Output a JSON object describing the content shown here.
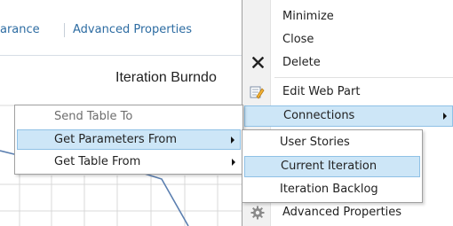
{
  "tabs": {
    "appearance": "arance",
    "advanced_properties": "Advanced Properties"
  },
  "chart": {
    "title": "Iteration Burndo"
  },
  "main_menu": {
    "minimize": "Minimize",
    "close": "Close",
    "delete": "Delete",
    "edit_web_part": "Edit Web Part",
    "connections": "Connections",
    "advanced_properties": "Advanced Properties"
  },
  "left_menu": {
    "send_table_to": "Send Table To",
    "get_parameters_from": "Get Parameters From",
    "get_table_from": "Get Table From"
  },
  "right_menu": {
    "user_stories": "User Stories",
    "current_iteration": "Current Iteration",
    "iteration_backlog": "Iteration Backlog"
  },
  "colors": {
    "link": "#2d6ca2",
    "selection": "#cde6f7",
    "selection_border": "#8fc1e6",
    "chart_line": "#5b7fb0"
  },
  "icons": [
    "delete-x-icon",
    "edit-web-part-icon",
    "gear-icon"
  ]
}
